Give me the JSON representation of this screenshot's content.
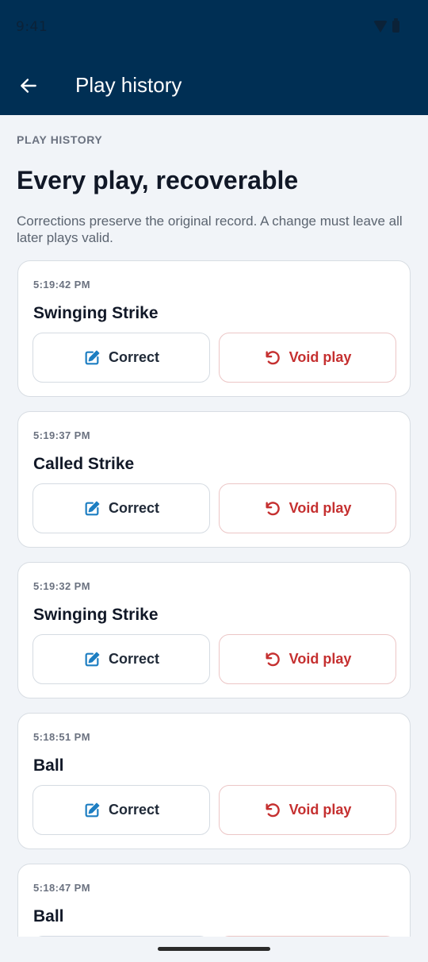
{
  "status_bar": {
    "time": "9:41"
  },
  "app_bar": {
    "title": "Play history"
  },
  "section": {
    "overline": "PLAY HISTORY",
    "heading": "Every play, recoverable",
    "description": "Corrections preserve the original record. A change must leave all later plays valid."
  },
  "actions": {
    "correct_label": "Correct",
    "void_label": "Void play"
  },
  "plays": [
    {
      "time": "5:19:42 PM",
      "title": "Swinging Strike"
    },
    {
      "time": "5:19:37 PM",
      "title": "Called Strike"
    },
    {
      "time": "5:19:32 PM",
      "title": "Swinging Strike"
    },
    {
      "time": "5:18:51 PM",
      "title": "Ball"
    },
    {
      "time": "5:18:47 PM",
      "title": "Ball"
    }
  ],
  "colors": {
    "header_bg": "#002f54",
    "accent_blue": "#1d7ec2",
    "void_red": "#c53030",
    "page_bg": "#f1f4f8"
  },
  "icons": {
    "back": "arrow-left-icon",
    "correct": "edit-icon",
    "void": "undo-icon",
    "wifi": "wifi-icon",
    "battery": "battery-icon"
  }
}
